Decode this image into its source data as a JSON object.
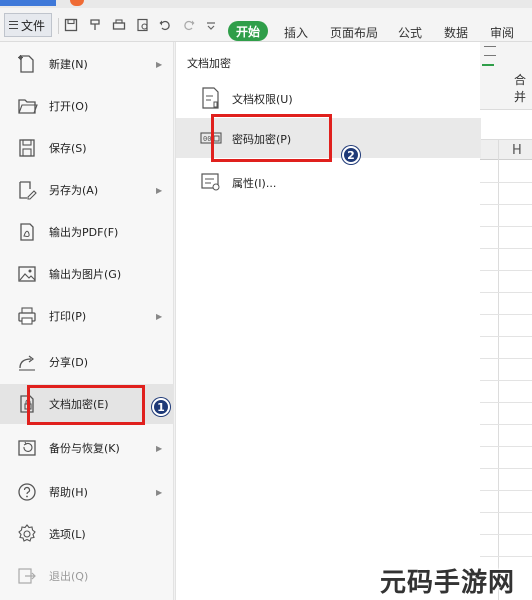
{
  "toolbar": {
    "file_label": "文件",
    "start_label": "开始",
    "tabs": [
      "插入",
      "页面布局",
      "公式",
      "数据",
      "审阅"
    ]
  },
  "sheet": {
    "column_label": "H",
    "ribbon_label": "合并"
  },
  "menu": {
    "items": [
      {
        "label": "新建(N)",
        "icon": "new-file-icon",
        "has_submenu": true
      },
      {
        "label": "打开(O)",
        "icon": "folder-open-icon",
        "has_submenu": false
      },
      {
        "label": "保存(S)",
        "icon": "save-icon",
        "has_submenu": false
      },
      {
        "label": "另存为(A)",
        "icon": "save-as-icon",
        "has_submenu": true
      },
      {
        "label": "输出为PDF(F)",
        "icon": "pdf-export-icon",
        "has_submenu": false
      },
      {
        "label": "输出为图片(G)",
        "icon": "image-export-icon",
        "has_submenu": false
      },
      {
        "label": "打印(P)",
        "icon": "printer-icon",
        "has_submenu": true
      },
      {
        "label": "分享(D)",
        "icon": "share-icon",
        "has_submenu": false
      },
      {
        "label": "文档加密(E)",
        "icon": "document-lock-icon",
        "has_submenu": true
      },
      {
        "label": "备份与恢复(K)",
        "icon": "backup-icon",
        "has_submenu": true
      },
      {
        "label": "帮助(H)",
        "icon": "help-icon",
        "has_submenu": true
      },
      {
        "label": "选项(L)",
        "icon": "gear-icon",
        "has_submenu": false
      },
      {
        "label": "退出(Q)",
        "icon": "exit-icon",
        "has_submenu": false
      }
    ]
  },
  "submenu": {
    "title": "文档加密",
    "items": [
      {
        "label": "文档权限(U)",
        "icon": "document-permission-icon"
      },
      {
        "label": "密码加密(P)",
        "icon": "password-encrypt-icon"
      },
      {
        "label": "属性(I)...",
        "icon": "properties-icon"
      }
    ]
  },
  "annotations": {
    "marker_1": "1",
    "marker_2": "2"
  },
  "watermark": "元码手游网",
  "colors": {
    "accent_green": "#2f9e49",
    "highlight_red": "#e0201d",
    "marker_blue": "#1f3a78"
  }
}
